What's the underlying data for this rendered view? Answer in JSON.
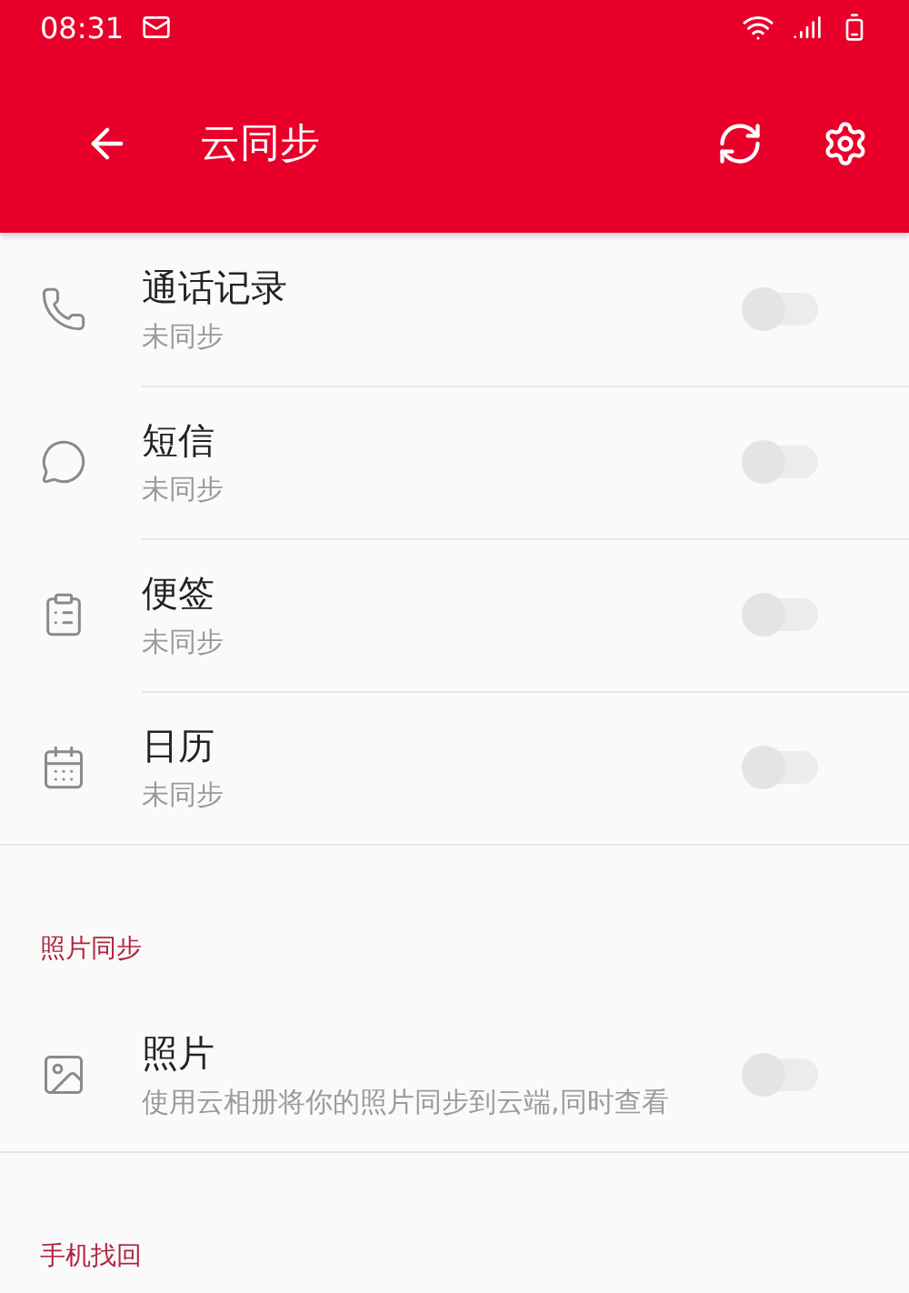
{
  "status_bar": {
    "time": "08:31"
  },
  "app_bar": {
    "title": "云同步"
  },
  "sections": [
    {
      "items": [
        {
          "title": "通话记录",
          "subtitle": "未同步",
          "on": false
        },
        {
          "title": "短信",
          "subtitle": "未同步",
          "on": false
        },
        {
          "title": "便签",
          "subtitle": "未同步",
          "on": false
        },
        {
          "title": "日历",
          "subtitle": "未同步",
          "on": false
        }
      ]
    },
    {
      "title": "照片同步",
      "items": [
        {
          "title": "照片",
          "subtitle": "使用云相册将你的照片同步到云端,同时查看",
          "on": false
        }
      ]
    },
    {
      "title": "手机找回"
    }
  ]
}
